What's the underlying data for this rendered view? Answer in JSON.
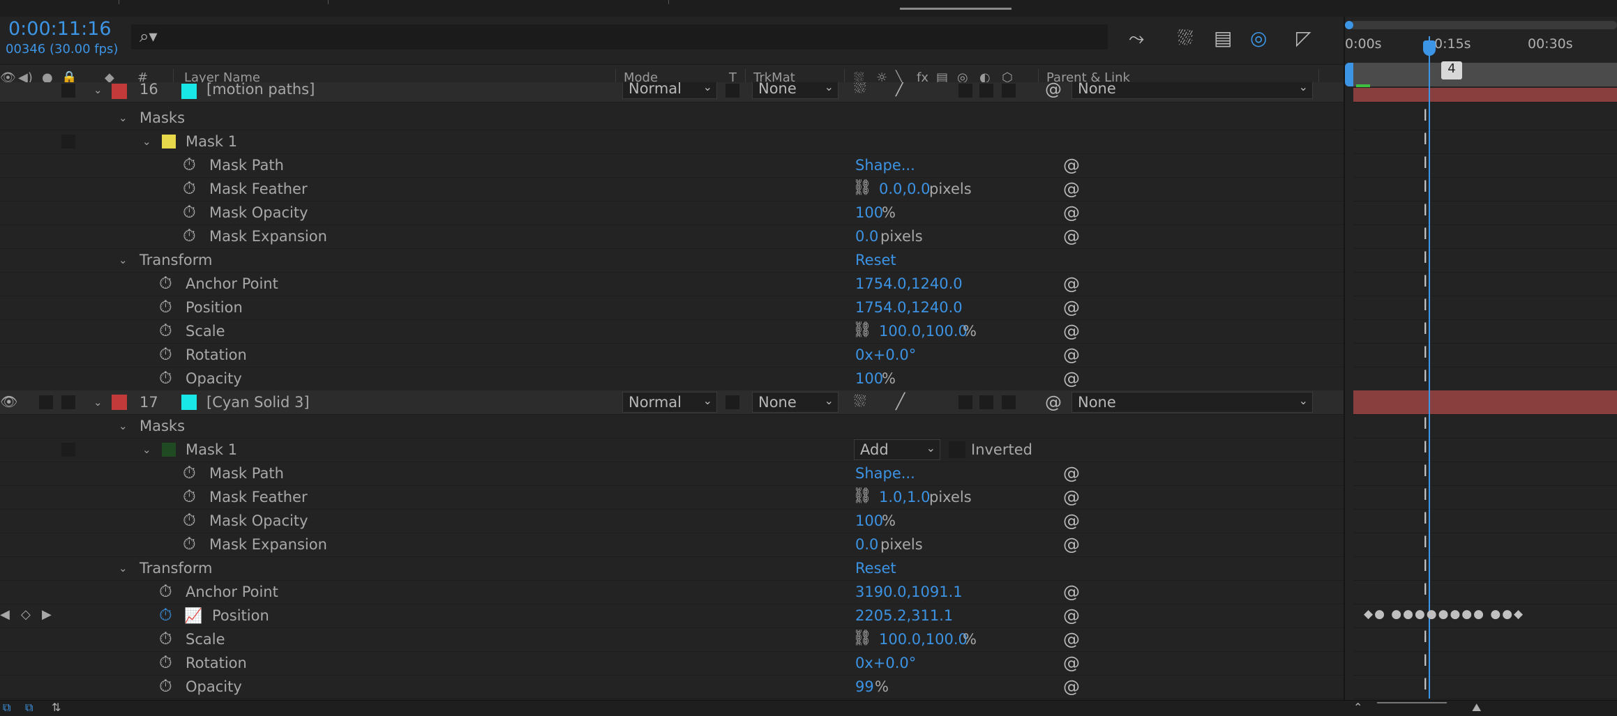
{
  "header": {
    "timecode": "0:00:11:16",
    "frames": "00346 (30.00 fps)",
    "search_icon": "search-icon"
  },
  "columns": {
    "layer_name": "Layer Name",
    "mode": "Mode",
    "t": "T",
    "trkmat": "TrkMat",
    "fx": "fx",
    "parent_link": "Parent & Link",
    "num": "#"
  },
  "timeline": {
    "ruler": [
      "0:00s",
      "0:15s",
      "00:30s"
    ],
    "marker_label": "4"
  },
  "layer16": {
    "num": "16",
    "name": "[motion paths]",
    "mode": "Normal",
    "trkmat": "None",
    "parent": "None",
    "label_color": "#c23a3a",
    "swatch": "#19e6e6",
    "masks_label": "Masks",
    "mask1_label": "Mask 1",
    "mask1_color": "#e6d84a",
    "mask_path": {
      "label": "Mask Path",
      "value": "Shape..."
    },
    "mask_feather": {
      "label": "Mask Feather",
      "value": "0.0,0.0",
      "unit": "pixels"
    },
    "mask_opacity": {
      "label": "Mask Opacity",
      "value": "100",
      "unit": "%"
    },
    "mask_expansion": {
      "label": "Mask Expansion",
      "value": "0.0",
      "unit": "pixels"
    },
    "transform_label": "Transform",
    "reset": "Reset",
    "anchor": {
      "label": "Anchor Point",
      "value": "1754.0,1240.0"
    },
    "position": {
      "label": "Position",
      "value": "1754.0,1240.0"
    },
    "scale": {
      "label": "Scale",
      "value": "100.0,100.0",
      "unit": "%"
    },
    "rotation": {
      "label": "Rotation",
      "value": "0x+0.0°"
    },
    "opacity": {
      "label": "Opacity",
      "value": "100",
      "unit": "%"
    }
  },
  "layer17": {
    "num": "17",
    "name": "[Cyan Solid 3]",
    "mode": "Normal",
    "trkmat": "None",
    "parent": "None",
    "label_color": "#c23a3a",
    "swatch": "#19e6e6",
    "masks_label": "Masks",
    "mask1_label": "Mask 1",
    "mask1_color": "#1f4a22",
    "mask_mode": "Add",
    "inverted": "Inverted",
    "mask_path": {
      "label": "Mask Path",
      "value": "Shape..."
    },
    "mask_feather": {
      "label": "Mask Feather",
      "value": "1.0,1.0",
      "unit": "pixels"
    },
    "mask_opacity": {
      "label": "Mask Opacity",
      "value": "100",
      "unit": "%"
    },
    "mask_expansion": {
      "label": "Mask Expansion",
      "value": "0.0",
      "unit": "pixels"
    },
    "transform_label": "Transform",
    "reset": "Reset",
    "anchor": {
      "label": "Anchor Point",
      "value": "3190.0,1091.1"
    },
    "position": {
      "label": "Position",
      "value": "2205.2,311.1"
    },
    "scale": {
      "label": "Scale",
      "value": "100.0,100.0",
      "unit": "%"
    },
    "rotation": {
      "label": "Rotation",
      "value": "0x+0.0°"
    },
    "opacity": {
      "label": "Opacity",
      "value": "99",
      "unit": "%"
    }
  },
  "colors": {
    "accent_blue": "#3c93e3",
    "layer_bar": "#8a3f3f"
  }
}
